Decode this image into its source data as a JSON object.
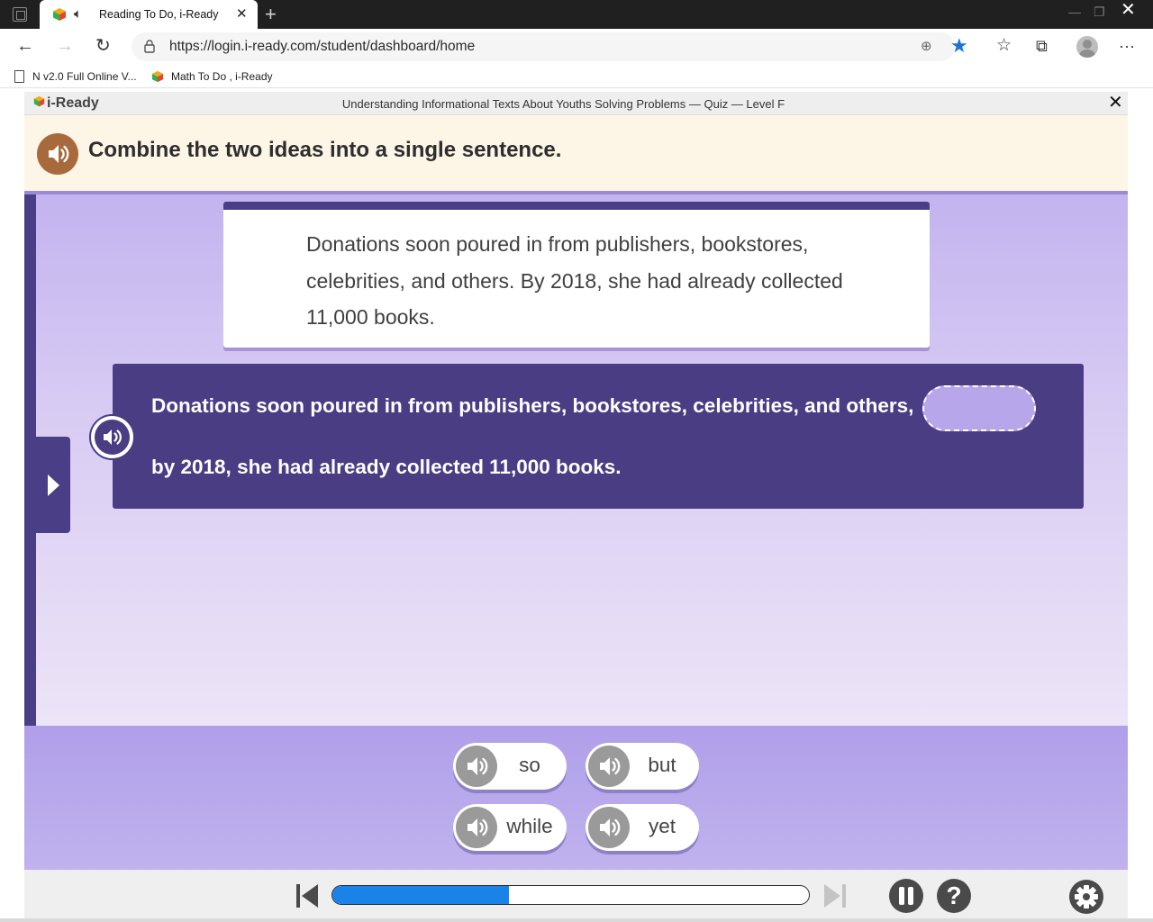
{
  "browser": {
    "tab": {
      "title": "Reading To Do, i-Ready",
      "audio_icon": "speaker-icon",
      "close_icon": "close-icon"
    },
    "new_tab_icon": "plus-icon",
    "address_bar": {
      "url": "https://login.i-ready.com/student/dashboard/home"
    },
    "bookmarks": [
      {
        "label": "N v2.0 Full Online V...",
        "icon": "page-icon"
      },
      {
        "label": "Math To Do , i-Ready",
        "icon": "iready-cube-icon"
      }
    ],
    "accent_color": "#1a73d8"
  },
  "app": {
    "logo": "i-Ready",
    "lesson_title": "Understanding Informational Texts About Youths Solving Problems — Quiz — Level F",
    "close_label": "✕",
    "instruction": "Combine the two ideas into a single sentence.",
    "passage": "Donations soon poured in from publishers, bookstores, celebrities, and others. By 2018, she had already collected 11,000 books.",
    "sentence": {
      "before_blank": "Donations soon poured in from publishers, bookstores, celebrities, and others,",
      "after_blank": "by 2018, she had already collected 11,000 books."
    },
    "choices": [
      {
        "label": "so"
      },
      {
        "label": "but"
      },
      {
        "label": "while"
      },
      {
        "label": "yet"
      }
    ],
    "footer": {
      "progress_fraction": 0.37,
      "help_label": "?"
    },
    "colors": {
      "primary_purple": "#4a3d84",
      "instruction_bg": "#fdf5e6",
      "audio_brown": "#a86a3c",
      "progress_blue": "#1a83e8"
    }
  }
}
